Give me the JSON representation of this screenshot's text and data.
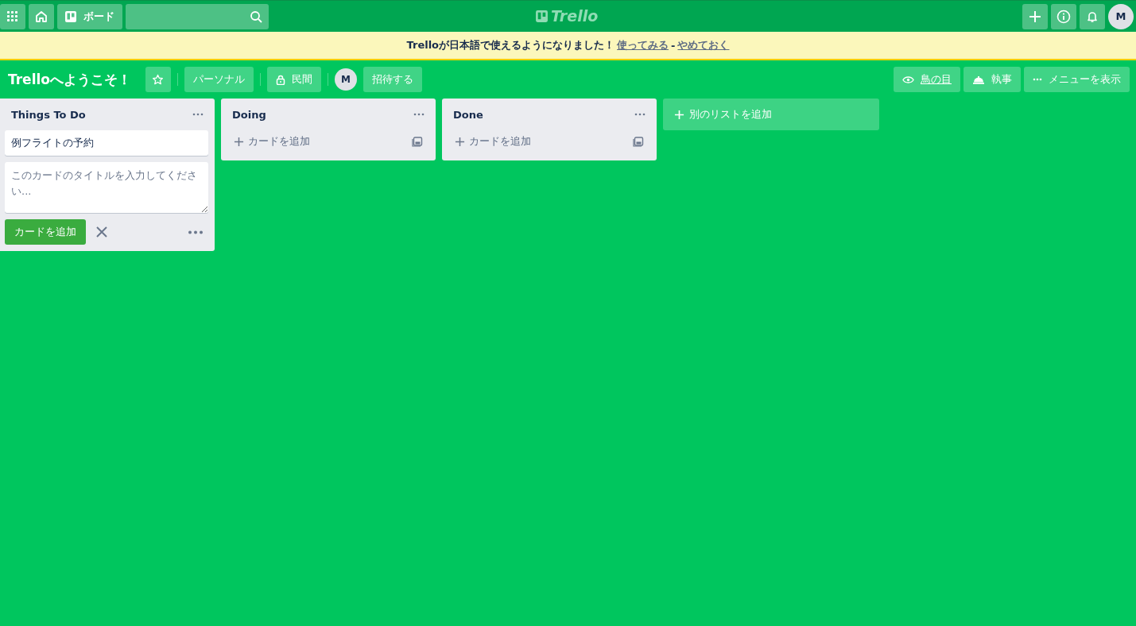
{
  "header": {
    "boards_label": "ボード",
    "logo": "Trello",
    "avatar": "M"
  },
  "banner": {
    "message": "Trelloが日本語で使えるようになりました！",
    "links": [
      "使ってみる",
      "やめておく"
    ],
    "separator": "-"
  },
  "board": {
    "title": "Trelloへようこそ！",
    "team": "パーソナル",
    "visibility": "民間",
    "member": "M",
    "invite": "招待する",
    "actions": [
      {
        "kind": "eye",
        "label": "鳥の目"
      },
      {
        "kind": "bell",
        "label": "執事"
      },
      {
        "kind": "more",
        "label": "メニューを表示"
      }
    ]
  },
  "lists": [
    {
      "title": "Things To Do",
      "cards": [
        "例フライトの予約"
      ],
      "composer": {
        "placeholder": "このカードのタイトルを入力してください...",
        "button": "カードを追加"
      }
    },
    {
      "title": "Doing",
      "add_card_label": "カードを追加"
    },
    {
      "title": "Done",
      "add_card_label": "カードを追加"
    }
  ],
  "add_list_label": "別のリストを追加"
}
